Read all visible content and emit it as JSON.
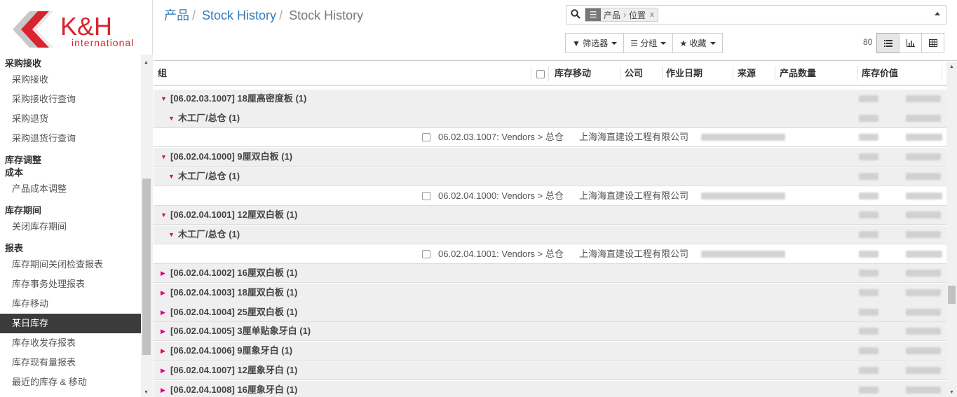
{
  "brand": {
    "name": "K&H",
    "tagline": "international",
    "red": "#d9232e",
    "gray": "#c8c8c8"
  },
  "breadcrumb": [
    "产品",
    "Stock History",
    "Stock History"
  ],
  "search": {
    "facet_values": [
      "产品",
      "位置"
    ],
    "remove_label": "x"
  },
  "buttons": {
    "filter": "筛选器",
    "groupby": "分组",
    "favorites": "收藏"
  },
  "pager": {
    "value": "80"
  },
  "sidebar": {
    "sections": [
      {
        "title": "采购接收",
        "items": [
          "采购接收",
          "采购接收行查询",
          "采购退货",
          "采购退货行查询"
        ]
      },
      {
        "title": "库存调整",
        "items": []
      },
      {
        "title": "成本",
        "items": [
          "产品成本调整"
        ]
      },
      {
        "title": "库存期间",
        "items": [
          "关闭库存期间"
        ]
      },
      {
        "title": "报表",
        "items": [
          "库存期间关闭检查报表",
          "库存事务处理报表",
          "库存移动",
          "某日库存",
          "库存收发存报表",
          "库存现有量报表",
          "最近的库存 & 移动"
        ]
      }
    ],
    "active_item": "某日库存"
  },
  "table": {
    "columns": [
      "组",
      "库存移动",
      "公司",
      "作业日期",
      "来源",
      "产品数量",
      "库存价值"
    ],
    "rows": [
      {
        "type": "g1",
        "open": true,
        "label": "[06.02.03.1007] 18厘高密度板 (1)"
      },
      {
        "type": "g2",
        "open": true,
        "label": "木工厂/总仓 (1)"
      },
      {
        "type": "rec",
        "move": "06.02.03.1007: Vendors > 总仓",
        "company": "上海海直建设工程有限公司"
      },
      {
        "type": "g1",
        "open": true,
        "label": "[06.02.04.1000] 9厘双白板 (1)"
      },
      {
        "type": "g2",
        "open": true,
        "label": "木工厂/总仓 (1)"
      },
      {
        "type": "rec",
        "move": "06.02.04.1000: Vendors > 总仓",
        "company": "上海海直建设工程有限公司"
      },
      {
        "type": "g1",
        "open": true,
        "label": "[06.02.04.1001] 12厘双白板 (1)"
      },
      {
        "type": "g2",
        "open": true,
        "label": "木工厂/总仓 (1)"
      },
      {
        "type": "rec",
        "move": "06.02.04.1001: Vendors > 总仓",
        "company": "上海海直建设工程有限公司"
      },
      {
        "type": "g1",
        "open": false,
        "label": "[06.02.04.1002] 16厘双白板 (1)"
      },
      {
        "type": "g1",
        "open": false,
        "label": "[06.02.04.1003] 18厘双白板 (1)"
      },
      {
        "type": "g1",
        "open": false,
        "label": "[06.02.04.1004] 25厘双白板 (1)"
      },
      {
        "type": "g1",
        "open": false,
        "label": "[06.02.04.1005] 3厘单贴象牙白 (1)"
      },
      {
        "type": "g1",
        "open": false,
        "label": "[06.02.04.1006] 9厘象牙白 (1)"
      },
      {
        "type": "g1",
        "open": false,
        "label": "[06.02.04.1007] 12厘象牙白 (1)"
      },
      {
        "type": "g1",
        "open": false,
        "label": "[06.02.04.1008] 16厘象牙白 (1)"
      }
    ]
  }
}
